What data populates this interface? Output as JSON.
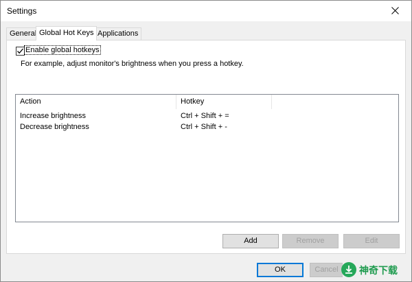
{
  "window": {
    "title": "Settings"
  },
  "tabs": [
    {
      "label": "General"
    },
    {
      "label": "Global Hot Keys"
    },
    {
      "label": "Applications"
    }
  ],
  "hotkeys_tab": {
    "enable_checkbox": {
      "label": "Enable global hotkeys",
      "checked": true
    },
    "description": "For example, adjust monitor's brightness when you press a hotkey.",
    "list": {
      "columns": [
        "Action",
        "Hotkey"
      ],
      "rows": [
        {
          "action": "Increase brightness",
          "hotkey": "Ctrl + Shift + ="
        },
        {
          "action": "Decrease brightness",
          "hotkey": "Ctrl + Shift + -"
        }
      ]
    },
    "buttons": {
      "add": "Add",
      "remove": "Remove",
      "edit": "Edit"
    }
  },
  "dialog_buttons": {
    "ok": "OK",
    "cancel": "Cancel"
  },
  "watermark": {
    "text": "神奇下载",
    "icon": "download-logo-icon"
  },
  "colors": {
    "focus_border": "#0078d7",
    "watermark_green": "#26a85a"
  }
}
